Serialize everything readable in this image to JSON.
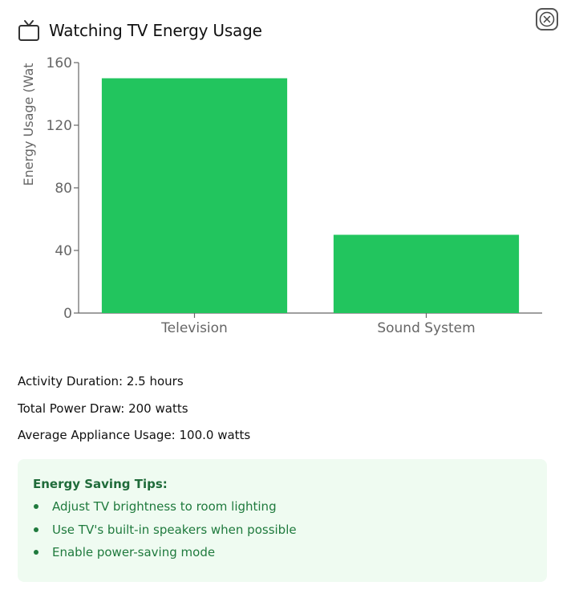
{
  "header": {
    "title": "Watching TV Energy Usage",
    "icon": "tv-icon"
  },
  "close": {
    "icon": "close-icon"
  },
  "chart_data": {
    "type": "bar",
    "categories": [
      "Television",
      "Sound System"
    ],
    "values": [
      150,
      50
    ],
    "ylabel": "Energy Usage (Wat",
    "ylim": [
      0,
      160
    ],
    "yticks": [
      0,
      40,
      80,
      120,
      160
    ],
    "xlabel": "",
    "title": "",
    "grid": false,
    "bar_color": "#22c55e"
  },
  "stats": {
    "duration": "Activity Duration: 2.5 hours",
    "power": "Total Power Draw: 200 watts",
    "average": "Average Appliance Usage: 100.0 watts"
  },
  "tips": {
    "title": "Energy Saving Tips:",
    "items": [
      "Adjust TV brightness to room lighting",
      "Use TV's built-in speakers when possible",
      "Enable power-saving mode"
    ]
  },
  "colors": {
    "bar": "#22c55e",
    "tips_background": "#effbf1",
    "tips_text": "#1f7a3d",
    "axis": "#666666"
  }
}
